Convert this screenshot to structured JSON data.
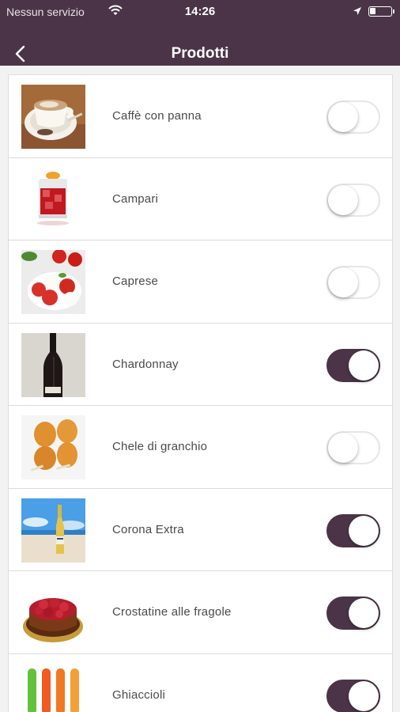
{
  "status_bar": {
    "carrier": "Nessun servizio",
    "time": "14:26",
    "battery_level": 0.25
  },
  "nav": {
    "title": "Prodotti"
  },
  "colors": {
    "accent": "#4b3448",
    "toggle_off_border": "#e6e6e6"
  },
  "products": [
    {
      "name": "Caffè con panna",
      "enabled": false,
      "image": "coffee-cup-image"
    },
    {
      "name": "Campari",
      "enabled": false,
      "image": "campari-glass-image"
    },
    {
      "name": "Caprese",
      "enabled": false,
      "image": "caprese-salad-image"
    },
    {
      "name": "Chardonnay",
      "enabled": true,
      "image": "wine-bottle-image"
    },
    {
      "name": "Chele di granchio",
      "enabled": false,
      "image": "crab-claws-image"
    },
    {
      "name": "Corona Extra",
      "enabled": true,
      "image": "beer-bottle-image"
    },
    {
      "name": "Crostatine alle fragole",
      "enabled": true,
      "image": "strawberry-tart-image"
    },
    {
      "name": "Ghiaccioli",
      "enabled": true,
      "image": "popsicles-image"
    }
  ]
}
